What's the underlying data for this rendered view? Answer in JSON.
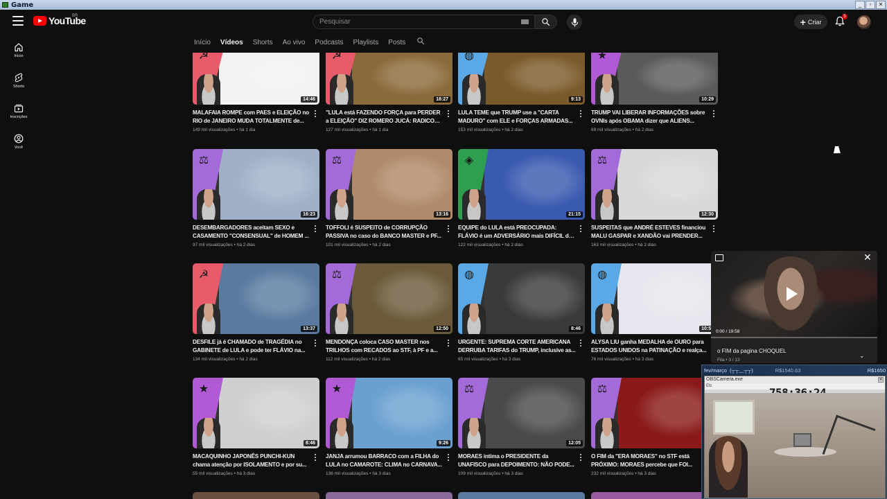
{
  "os": {
    "window_title": "Game"
  },
  "header": {
    "logo_text": "YouTube",
    "region": "BR",
    "search_placeholder": "Pesquisar",
    "create_label": "Criar",
    "notifications_count": "5"
  },
  "guide": [
    {
      "label": "Início",
      "icon": "home-icon"
    },
    {
      "label": "Shorts",
      "icon": "shorts-icon"
    },
    {
      "label": "Inscrições",
      "icon": "subscriptions-icon"
    },
    {
      "label": "Você",
      "icon": "you-icon"
    }
  ],
  "tabs": [
    {
      "label": "Início",
      "active": false
    },
    {
      "label": "Vídeos",
      "active": true
    },
    {
      "label": "Shorts",
      "active": false
    },
    {
      "label": "Ao vivo",
      "active": false
    },
    {
      "label": "Podcasts",
      "active": false
    },
    {
      "label": "Playlists",
      "active": false
    },
    {
      "label": "Posts",
      "active": false
    }
  ],
  "videos": [
    {
      "title": "MALAFAIA ROMPE com PAES e ELEIÇÃO no RIO de JANEIRO MUDA TOTALMENTE de...",
      "views": "149 mil visualizações",
      "age": "há 1 dia",
      "duration": "14:46",
      "wedge_color": "#e85b6a",
      "icon": "hammer-sickle-icon",
      "scene_color": "#f2f2f2"
    },
    {
      "title": "\"LULA está FAZENDO FORÇA para PERDER a ELEIÇÃO\" DIZ ROMERO JUCÁ: RADICOU na...",
      "views": "127 mil visualizações",
      "age": "há 1 dia",
      "duration": "18:27",
      "wedge_color": "#e85b6a",
      "icon": "hammer-sickle-icon",
      "scene_color": "#8a6a3a"
    },
    {
      "title": "LULA TEME que TRUMP use a \"CARTA MADURO\" com ELE e FORÇAS ARMADAS...",
      "views": "153 mil visualizações",
      "age": "há 2 dias",
      "duration": "9:13",
      "wedge_color": "#5aa9e6",
      "icon": "globe-icon",
      "scene_color": "#7a5a2a"
    },
    {
      "title": "TRUMP VAI LIBERAR INFORMAÇÕES sobre OVNIs após OBAMA dizer que ALIENS...",
      "views": "69 mil visualizações",
      "age": "há 2 dias",
      "duration": "10:29",
      "wedge_color": "#b05ad6",
      "icon": "star-icon",
      "scene_color": "#5a5a5a"
    },
    {
      "title": "DESEMBARGADORES aceitam SEXO e CASAMENTO \"CONSENSUAL\" de HOMEM ...",
      "views": "97 mil visualizações",
      "age": "há 2 dias",
      "duration": "16:23",
      "wedge_color": "#a56ad9",
      "icon": "scales-icon",
      "scene_color": "#9fb0c8"
    },
    {
      "title": "TOFFOLI é SUSPEITO de CORRUPÇÃO PASSIVA no caso do BANCO MASTER e PF...",
      "views": "101 mil visualizações",
      "age": "há 2 dias",
      "duration": "13:16",
      "wedge_color": "#a56ad9",
      "icon": "scales-icon",
      "scene_color": "#b08a6a"
    },
    {
      "title": "EQUIPE do LULA está PREOCUPADA: FLÁVIO é um ADVERSÁRIO mais DIFÍCIL do que o...",
      "views": "122 mil visualizações",
      "age": "há 2 dias",
      "duration": "21:15",
      "wedge_color": "#2e9e4f",
      "icon": "brazil-flag-icon",
      "scene_color": "#3a5ab0"
    },
    {
      "title": "SUSPEITAS que ANDRÉ ESTEVES financiou MALU GASPAR e XANDÃO vai PRENDER...",
      "views": "163 mil visualizações",
      "age": "há 2 dias",
      "duration": "12:30",
      "wedge_color": "#a56ad9",
      "icon": "scales-icon",
      "scene_color": "#d8d8d8"
    },
    {
      "title": "DESFILE já é CHAMADO de TRAGÉDIA no GABINETE de LULA e pode ter FLÁVIO na...",
      "views": "134 mil visualizações",
      "age": "há 2 dias",
      "duration": "13:37",
      "wedge_color": "#e85b6a",
      "icon": "hammer-sickle-icon",
      "scene_color": "#5a7aa0"
    },
    {
      "title": "MENDONÇA coloca CASO MASTER nos TRILHOS com RECADOS ao STF, à PF e a...",
      "views": "112 mil visualizações",
      "age": "há 2 dias",
      "duration": "12:50",
      "wedge_color": "#a56ad9",
      "icon": "scales-icon",
      "scene_color": "#6a5a3a"
    },
    {
      "title": "URGENTE: SUPREMA CORTE AMERICANA DERRUBA TARIFAS do TRUMP, inclusive as...",
      "views": "65 mil visualizações",
      "age": "há 3 dias",
      "duration": "8:46",
      "wedge_color": "#5aa9e6",
      "icon": "globe-icon",
      "scene_color": "#3a3a3a"
    },
    {
      "title": "ALYSA LIU ganha MEDALHA de OURO para ESTADOS UNIDOS na PATINAÇÃO e realça...",
      "views": "76 mil visualizações",
      "age": "há 3 dias",
      "duration": "10:54",
      "wedge_color": "#5aa9e6",
      "icon": "globe-icon",
      "scene_color": "#e6e6ee"
    },
    {
      "title": "MACAQUINHO JAPONÊS PUNCHI-KUN chama atenção por ISOLAMENTO e por su...",
      "views": "55 mil visualizações",
      "age": "há 3 dias",
      "duration": "8:46",
      "wedge_color": "#b05ad6",
      "icon": "star-icon",
      "scene_color": "#cfcfcf"
    },
    {
      "title": "JANJA arrumou BARRACO com a FILHA do LULA no CAMAROTE: CLIMA no CARNAVA...",
      "views": "136 mil visualizações",
      "age": "há 3 dias",
      "duration": "9:26",
      "wedge_color": "#b05ad6",
      "icon": "star-icon",
      "scene_color": "#6aa0d0"
    },
    {
      "title": "MORAES intima o PRESIDENTE da UNAFISCO para DEPOIMENTO: NÃO PODE...",
      "views": "109 mil visualizações",
      "age": "há 3 dias",
      "duration": "12:05",
      "wedge_color": "#a56ad9",
      "icon": "scales-icon",
      "scene_color": "#4a4a4a"
    },
    {
      "title": "O FIM da \"ERA MORAES\" no STF está PRÓXIMO: MORAES percebe que FOI...",
      "views": "232 mil visualizações",
      "age": "há 3 dias",
      "duration": "",
      "wedge_color": "#a56ad9",
      "icon": "scales-icon",
      "scene_color": "#8a1a1a"
    }
  ],
  "miniplayer": {
    "time": "0:00 / 19:58",
    "progress": 0.0,
    "title": "o FIM da pagina CHOQUEL",
    "queue": "Fila • 3 / 13"
  },
  "overlay": {
    "month": "fev/março",
    "month_emote": "(┬┬﹏┬┬)",
    "amount_mid": "R$1540.63",
    "amount_right": "R$1650",
    "window_title": "OBSCamera.exe",
    "window_menu": "Etc",
    "clock": "758:36:24"
  },
  "colors": {
    "background": "#0f0f0f",
    "accent": "#ff0000",
    "text_primary": "#f1f1f1",
    "text_secondary": "#aaaaaa"
  }
}
